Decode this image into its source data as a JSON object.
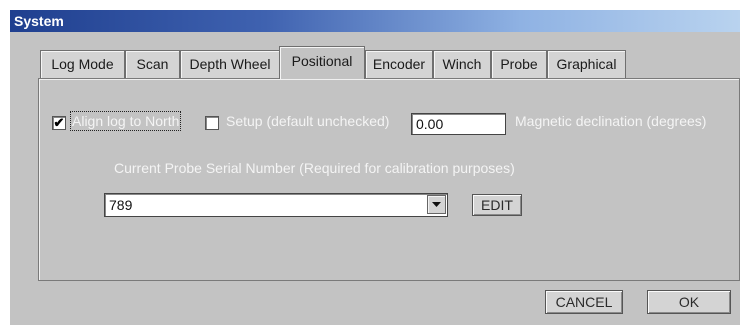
{
  "window": {
    "title": "System"
  },
  "tabs": [
    {
      "label": "Log Mode",
      "active": false
    },
    {
      "label": "Scan",
      "active": false
    },
    {
      "label": "Depth Wheel",
      "active": false
    },
    {
      "label": "Positional",
      "active": true
    },
    {
      "label": "Encoder",
      "active": false
    },
    {
      "label": "Winch",
      "active": false
    },
    {
      "label": "Probe",
      "active": false
    },
    {
      "label": "Graphical",
      "active": false
    }
  ],
  "positional": {
    "align_north": {
      "label": "Align log to North",
      "checked": true
    },
    "setup": {
      "label": "Setup (default unchecked)",
      "checked": false
    },
    "declination": {
      "value": "0.00",
      "label": "Magnetic declination (degrees)"
    },
    "serial": {
      "label": "Current Probe Serial Number  (Required for calibration purposes)",
      "value": "789"
    },
    "edit_label": "EDIT"
  },
  "footer": {
    "cancel_label": "CANCEL",
    "ok_label": "OK"
  },
  "icons": {
    "checkmark": "checkmark-icon",
    "dropdown": "chevron-down-icon"
  },
  "colors": {
    "title_start": "#1f3f8f",
    "title_end": "#b9d3ef",
    "face": "#c3c3c3"
  }
}
